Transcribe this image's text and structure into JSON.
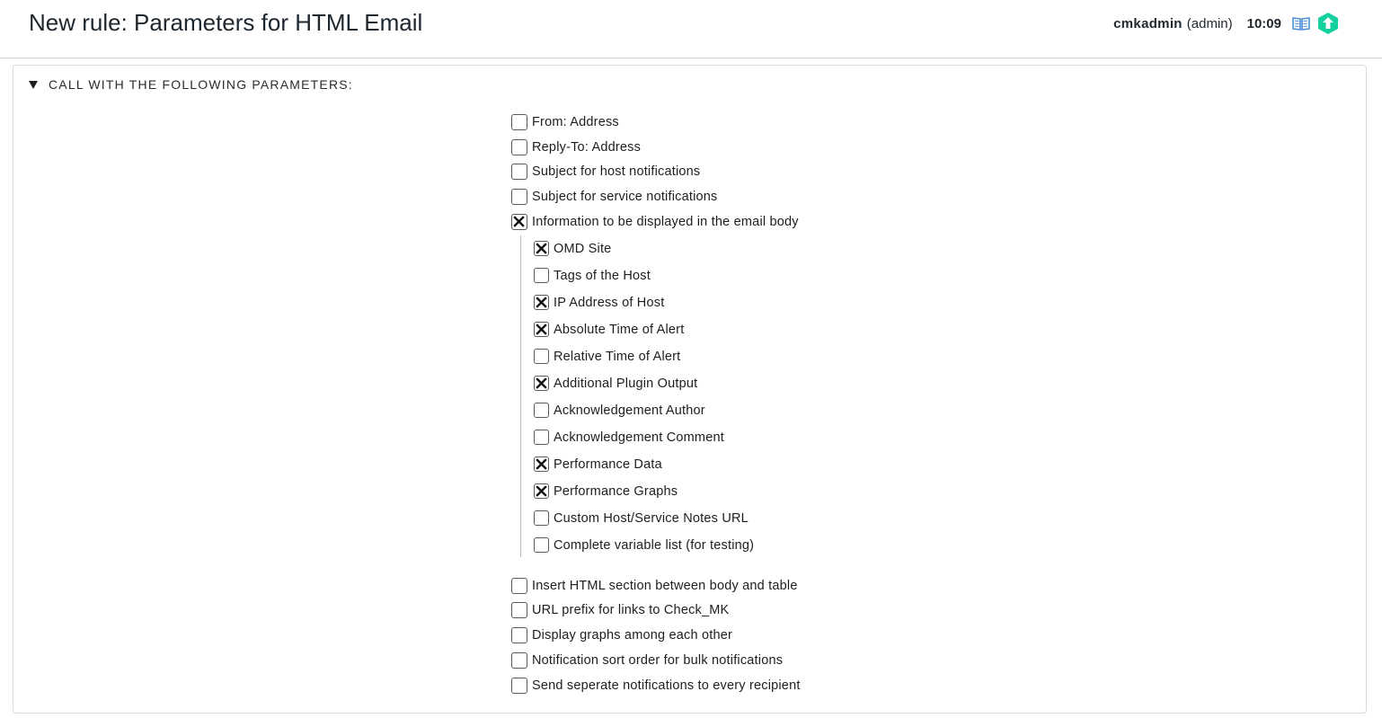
{
  "header": {
    "title": "New rule: Parameters for HTML Email",
    "user_name": "cmkadmin",
    "user_role": "(admin)",
    "clock": "10:09",
    "icons": [
      "book-icon",
      "checkmk-logo-icon"
    ],
    "logo_color": "#15d1a0"
  },
  "section": {
    "label": "CALL WITH THE FOLLOWING PARAMETERS:",
    "toggle_icon": "triangle-down-icon"
  },
  "top_options": [
    {
      "label": "From: Address",
      "checked": false
    },
    {
      "label": "Reply-To: Address",
      "checked": false
    },
    {
      "label": "Subject for host notifications",
      "checked": false
    },
    {
      "label": "Subject for service notifications",
      "checked": false
    },
    {
      "label": "Information to be displayed in the email body",
      "checked": true
    }
  ],
  "body_info_options": [
    {
      "label": "OMD Site",
      "checked": true
    },
    {
      "label": "Tags of the Host",
      "checked": false
    },
    {
      "label": "IP Address of Host",
      "checked": true
    },
    {
      "label": "Absolute Time of Alert",
      "checked": true
    },
    {
      "label": "Relative Time of Alert",
      "checked": false
    },
    {
      "label": "Additional Plugin Output",
      "checked": true
    },
    {
      "label": "Acknowledgement Author",
      "checked": false
    },
    {
      "label": "Acknowledgement Comment",
      "checked": false
    },
    {
      "label": "Performance Data",
      "checked": true
    },
    {
      "label": "Performance Graphs",
      "checked": true
    },
    {
      "label": "Custom Host/Service Notes URL",
      "checked": false
    },
    {
      "label": "Complete variable list (for testing)",
      "checked": false
    }
  ],
  "bottom_options": [
    {
      "label": "Insert HTML section between body and table",
      "checked": false
    },
    {
      "label": "URL prefix for links to Check_MK",
      "checked": false
    },
    {
      "label": "Display graphs among each other",
      "checked": false
    },
    {
      "label": "Notification sort order for bulk notifications",
      "checked": false
    },
    {
      "label": "Send seperate notifications to every recipient",
      "checked": false
    }
  ]
}
